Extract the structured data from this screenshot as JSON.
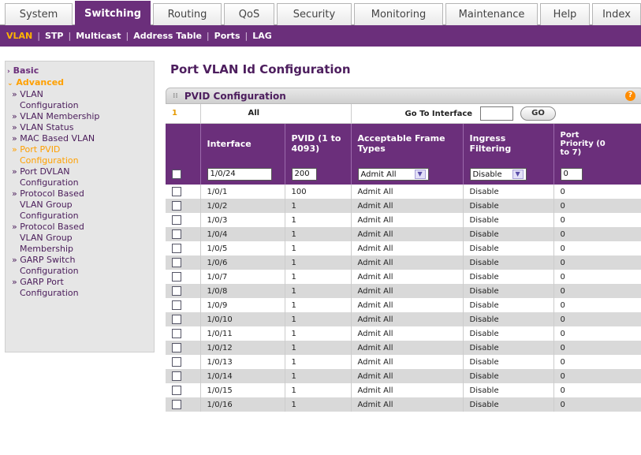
{
  "top_tabs": [
    "System",
    "Switching",
    "Routing",
    "QoS",
    "Security",
    "Monitoring",
    "Maintenance",
    "Help",
    "Index"
  ],
  "sub_nav": [
    "VLAN",
    "STP",
    "Multicast",
    "Address Table",
    "Ports",
    "LAG"
  ],
  "sidebar": {
    "basic": "Basic",
    "advanced": "Advanced",
    "items": [
      [
        "» VLAN",
        "Configuration"
      ],
      [
        "» VLAN Membership"
      ],
      [
        "» VLAN Status"
      ],
      [
        "» MAC Based VLAN"
      ],
      [
        "» Port PVID",
        "Configuration"
      ],
      [
        "» Port DVLAN",
        "Configuration"
      ],
      [
        "» Protocol Based",
        "VLAN Group",
        "Configuration"
      ],
      [
        "» Protocol Based",
        "VLAN Group",
        "Membership"
      ],
      [
        "» GARP Switch",
        "Configuration"
      ],
      [
        "» GARP Port",
        "Configuration"
      ]
    ]
  },
  "page_title": "Port VLAN Id Configuration",
  "panel": {
    "title": "PVID Configuration",
    "help": "?",
    "page_num": "1",
    "all_label": "All",
    "goto_label": "Go To Interface",
    "go_button": "GO"
  },
  "columns": {
    "interface": "Interface",
    "pvid_1": "PVID (1 to",
    "pvid_2": "4093)",
    "frame_1": "Acceptable Frame",
    "frame_2": "Types",
    "ingress_1": "Ingress",
    "ingress_2": "Filtering",
    "prio_1": "Port",
    "prio_2": "Priority (0",
    "prio_3": "to 7)"
  },
  "edit_row": {
    "interface": "1/0/24",
    "pvid": "200",
    "frame_types": "Admit All",
    "ingress": "Disable",
    "priority": "0"
  },
  "rows": [
    [
      "1/0/1",
      "100",
      "Admit All",
      "Disable",
      "0"
    ],
    [
      "1/0/2",
      "1",
      "Admit All",
      "Disable",
      "0"
    ],
    [
      "1/0/3",
      "1",
      "Admit All",
      "Disable",
      "0"
    ],
    [
      "1/0/4",
      "1",
      "Admit All",
      "Disable",
      "0"
    ],
    [
      "1/0/5",
      "1",
      "Admit All",
      "Disable",
      "0"
    ],
    [
      "1/0/6",
      "1",
      "Admit All",
      "Disable",
      "0"
    ],
    [
      "1/0/7",
      "1",
      "Admit All",
      "Disable",
      "0"
    ],
    [
      "1/0/8",
      "1",
      "Admit All",
      "Disable",
      "0"
    ],
    [
      "1/0/9",
      "1",
      "Admit All",
      "Disable",
      "0"
    ],
    [
      "1/0/10",
      "1",
      "Admit All",
      "Disable",
      "0"
    ],
    [
      "1/0/11",
      "1",
      "Admit All",
      "Disable",
      "0"
    ],
    [
      "1/0/12",
      "1",
      "Admit All",
      "Disable",
      "0"
    ],
    [
      "1/0/13",
      "1",
      "Admit All",
      "Disable",
      "0"
    ],
    [
      "1/0/14",
      "1",
      "Admit All",
      "Disable",
      "0"
    ],
    [
      "1/0/15",
      "1",
      "Admit All",
      "Disable",
      "0"
    ],
    [
      "1/0/16",
      "1",
      "Admit All",
      "Disable",
      "0"
    ]
  ]
}
